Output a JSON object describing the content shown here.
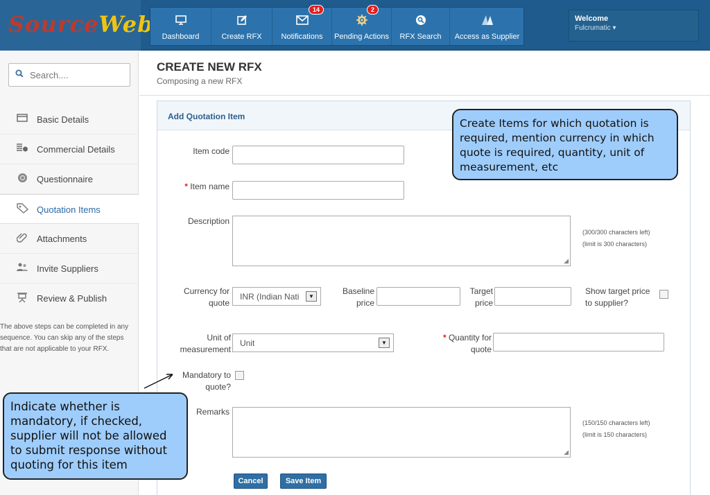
{
  "logo": {
    "part1": "Source",
    "part2": "Web"
  },
  "nav": {
    "items": [
      {
        "label": "Dashboard",
        "icon": "monitor-icon"
      },
      {
        "label": "Create RFX",
        "icon": "edit-icon"
      },
      {
        "label": "Notifications",
        "icon": "mail-icon",
        "badge": "14"
      },
      {
        "label": "Pending Actions",
        "icon": "gear-icon",
        "badge": "2"
      },
      {
        "label": "RFX Search",
        "icon": "search-icon"
      },
      {
        "label": "Access as Supplier",
        "icon": "supplier-icon"
      }
    ]
  },
  "user": {
    "welcome": "Welcome",
    "name": "Fulcrumatic"
  },
  "search": {
    "placeholder": "Search...."
  },
  "sidebar": {
    "items": [
      {
        "label": "Basic Details",
        "icon": "window-icon"
      },
      {
        "label": "Commercial Details",
        "icon": "coins-icon"
      },
      {
        "label": "Questionnaire",
        "icon": "question-icon"
      },
      {
        "label": "Quotation Items",
        "icon": "tag-icon",
        "active": true
      },
      {
        "label": "Attachments",
        "icon": "paperclip-icon"
      },
      {
        "label": "Invite Suppliers",
        "icon": "users-icon"
      },
      {
        "label": "Review & Publish",
        "icon": "easel-icon"
      }
    ],
    "note": "The above steps can be completed in any sequence. You can skip any of the steps that are not applicable to your RFX."
  },
  "page": {
    "title": "CREATE NEW RFX",
    "subtitle": "Composing a new RFX"
  },
  "panel": {
    "title": "Add Quotation Item"
  },
  "form": {
    "item_code_label": "Item code",
    "item_name_label": "Item name",
    "description_label": "Description",
    "description_hint1": "(300/300 characters left)",
    "description_hint2": "(limit is 300 characters)",
    "currency_label1": "Currency for",
    "currency_label2": "quote",
    "currency_value": "INR (Indian National Rupee)",
    "baseline_label1": "Baseline",
    "baseline_label2": "price",
    "target_label1": "Target",
    "target_label2": "price",
    "show_target_label1": "Show target price",
    "show_target_label2": "to supplier?",
    "uom_label1": "Unit of",
    "uom_label2": "measurement",
    "uom_value": "Unit",
    "quantity_label1": "Quantity for",
    "quantity_label2": "quote",
    "mandatory_label1": "Mandatory to",
    "mandatory_label2": "quote?",
    "remarks_label": "Remarks",
    "remarks_hint1": "(150/150 characters left)",
    "remarks_hint2": "(limit is 150 characters)",
    "cancel_label": "Cancel",
    "save_label": "Save Item",
    "required_mark": "*"
  },
  "callouts": {
    "items_note": "Create Items for which quotation is required, mention currency in which quote is required, quantity, unit of measurement, etc",
    "mandatory_note": "Indicate whether is mandatory, if checked, supplier will not be allowed to submit response without quoting for this item"
  },
  "colors": {
    "topbar": "#1f5b8c",
    "accent": "#2f6fa3",
    "callout": "#9fcdfb",
    "required": "#e02020"
  }
}
